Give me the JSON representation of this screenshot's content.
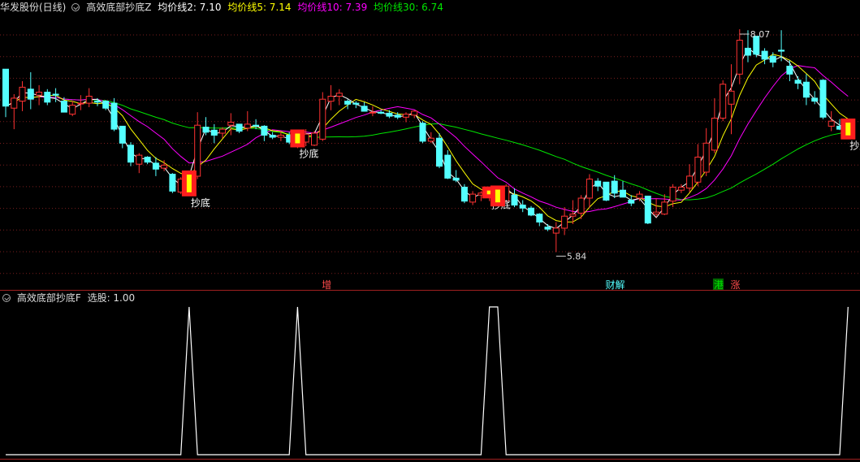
{
  "header": {
    "stock_name": "华发股份(日线)",
    "indicator_name": "高效底部抄底Z",
    "ma2_label": "均价线2: 7.10",
    "ma5_label": "均价线5: 7.14",
    "ma10_label": "均价线10: 7.39",
    "ma30_label": "均价线30: 6.74"
  },
  "sub_header": {
    "indicator_name": "高效底部抄底F",
    "value_label": "选股: 1.00"
  },
  "colors": {
    "background": "#000000",
    "up_candle": "#ff3232",
    "down_candle": "#54ffff",
    "ma2": "#ffffff",
    "ma5": "#ffff00",
    "ma10": "#ff00ff",
    "ma30": "#00e600",
    "grid": "#7a1e1e",
    "signal_line": "#ffffff"
  },
  "chart_data": [
    {
      "type": "candlestick",
      "title": "华发股份(日线)",
      "ylim": [
        5.6,
        8.2
      ],
      "price_high_label": "8.07",
      "price_low_label": "5.84",
      "signal_label": "抄底",
      "signal_indices": [
        22,
        35,
        58,
        59,
        101
      ],
      "markers": [
        {
          "text": "增",
          "index": 38,
          "color": "#ff4b4b"
        },
        {
          "text": "财解",
          "index": 72,
          "color": "#54ffff"
        },
        {
          "text": "港",
          "index": 85,
          "color": "#00e600",
          "box": "#006400"
        },
        {
          "text": "涨",
          "index": 87,
          "color": "#ff4b4b"
        }
      ],
      "candles": [
        {
          "o": 7.67,
          "h": 7.67,
          "l": 7.19,
          "c": 7.3
        },
        {
          "o": 7.28,
          "h": 7.42,
          "l": 7.07,
          "c": 7.38
        },
        {
          "o": 7.35,
          "h": 7.55,
          "l": 7.25,
          "c": 7.49
        },
        {
          "o": 7.47,
          "h": 7.64,
          "l": 7.27,
          "c": 7.37
        },
        {
          "o": 7.41,
          "h": 7.51,
          "l": 7.31,
          "c": 7.44
        },
        {
          "o": 7.44,
          "h": 7.47,
          "l": 7.31,
          "c": 7.34
        },
        {
          "o": 7.42,
          "h": 7.48,
          "l": 7.34,
          "c": 7.41
        },
        {
          "o": 7.35,
          "h": 7.39,
          "l": 7.24,
          "c": 7.24
        },
        {
          "o": 7.22,
          "h": 7.35,
          "l": 7.2,
          "c": 7.31
        },
        {
          "o": 7.33,
          "h": 7.41,
          "l": 7.26,
          "c": 7.33
        },
        {
          "o": 7.33,
          "h": 7.48,
          "l": 7.29,
          "c": 7.4
        },
        {
          "o": 7.35,
          "h": 7.38,
          "l": 7.3,
          "c": 7.34
        },
        {
          "o": 7.35,
          "h": 7.36,
          "l": 7.26,
          "c": 7.28
        },
        {
          "o": 7.33,
          "h": 7.38,
          "l": 7.05,
          "c": 7.07
        },
        {
          "o": 7.1,
          "h": 7.1,
          "l": 6.88,
          "c": 6.93
        },
        {
          "o": 6.91,
          "h": 6.94,
          "l": 6.7,
          "c": 6.74
        },
        {
          "o": 6.72,
          "h": 6.83,
          "l": 6.63,
          "c": 6.81
        },
        {
          "o": 6.79,
          "h": 6.8,
          "l": 6.72,
          "c": 6.74
        },
        {
          "o": 6.73,
          "h": 6.79,
          "l": 6.6,
          "c": 6.67
        },
        {
          "o": 6.68,
          "h": 6.76,
          "l": 6.65,
          "c": 6.71
        },
        {
          "o": 6.62,
          "h": 6.63,
          "l": 6.43,
          "c": 6.45
        },
        {
          "o": 6.44,
          "h": 6.59,
          "l": 6.42,
          "c": 6.57
        },
        {
          "o": 6.43,
          "h": 6.64,
          "l": 6.43,
          "c": 6.63
        },
        {
          "o": 6.6,
          "h": 7.24,
          "l": 6.57,
          "c": 7.11
        },
        {
          "o": 7.09,
          "h": 7.19,
          "l": 7.01,
          "c": 7.04
        },
        {
          "o": 7.06,
          "h": 7.12,
          "l": 6.93,
          "c": 7.01
        },
        {
          "o": 7.03,
          "h": 7.09,
          "l": 6.98,
          "c": 7.07
        },
        {
          "o": 7.11,
          "h": 7.23,
          "l": 7.01,
          "c": 7.14
        },
        {
          "o": 7.12,
          "h": 7.12,
          "l": 7.03,
          "c": 7.05
        },
        {
          "o": 7.08,
          "h": 7.25,
          "l": 7.05,
          "c": 7.12
        },
        {
          "o": 7.11,
          "h": 7.17,
          "l": 7.07,
          "c": 7.1
        },
        {
          "o": 7.1,
          "h": 7.11,
          "l": 6.95,
          "c": 7.01
        },
        {
          "o": 7.01,
          "h": 7.04,
          "l": 6.97,
          "c": 6.99
        },
        {
          "o": 6.99,
          "h": 7.05,
          "l": 6.95,
          "c": 7.01
        },
        {
          "o": 7.01,
          "h": 7.04,
          "l": 6.92,
          "c": 6.94
        },
        {
          "o": 6.92,
          "h": 7.05,
          "l": 6.88,
          "c": 7.03
        },
        {
          "o": 6.94,
          "h": 7.07,
          "l": 6.9,
          "c": 7.02
        },
        {
          "o": 6.91,
          "h": 7.05,
          "l": 6.9,
          "c": 7.03
        },
        {
          "o": 6.97,
          "h": 7.44,
          "l": 6.95,
          "c": 7.37
        },
        {
          "o": 7.35,
          "h": 7.51,
          "l": 7.26,
          "c": 7.4
        },
        {
          "o": 7.4,
          "h": 7.47,
          "l": 7.31,
          "c": 7.43
        },
        {
          "o": 7.35,
          "h": 7.37,
          "l": 7.27,
          "c": 7.32
        },
        {
          "o": 7.33,
          "h": 7.35,
          "l": 7.28,
          "c": 7.32
        },
        {
          "o": 7.3,
          "h": 7.34,
          "l": 7.25,
          "c": 7.25
        },
        {
          "o": 7.24,
          "h": 7.3,
          "l": 7.2,
          "c": 7.24
        },
        {
          "o": 7.24,
          "h": 7.26,
          "l": 7.22,
          "c": 7.23
        },
        {
          "o": 7.23,
          "h": 7.26,
          "l": 7.18,
          "c": 7.2
        },
        {
          "o": 7.21,
          "h": 7.24,
          "l": 7.17,
          "c": 7.19
        },
        {
          "o": 7.19,
          "h": 7.24,
          "l": 7.14,
          "c": 7.22
        },
        {
          "o": 7.21,
          "h": 7.26,
          "l": 7.18,
          "c": 7.25
        },
        {
          "o": 7.13,
          "h": 7.15,
          "l": 6.93,
          "c": 6.95
        },
        {
          "o": 6.95,
          "h": 7.04,
          "l": 6.93,
          "c": 6.98
        },
        {
          "o": 6.98,
          "h": 7.03,
          "l": 6.68,
          "c": 6.7
        },
        {
          "o": 6.81,
          "h": 6.86,
          "l": 6.57,
          "c": 6.58
        },
        {
          "o": 6.58,
          "h": 6.66,
          "l": 6.54,
          "c": 6.56
        },
        {
          "o": 6.49,
          "h": 6.52,
          "l": 6.33,
          "c": 6.35
        },
        {
          "o": 6.34,
          "h": 6.45,
          "l": 6.31,
          "c": 6.42
        },
        {
          "o": 6.41,
          "h": 6.45,
          "l": 6.35,
          "c": 6.43
        },
        {
          "o": 6.41,
          "h": 6.48,
          "l": 6.35,
          "c": 6.41
        },
        {
          "o": 6.33,
          "h": 6.49,
          "l": 6.31,
          "c": 6.46
        },
        {
          "o": 6.35,
          "h": 6.52,
          "l": 6.34,
          "c": 6.5
        },
        {
          "o": 6.41,
          "h": 6.48,
          "l": 6.29,
          "c": 6.31
        },
        {
          "o": 6.31,
          "h": 6.36,
          "l": 6.24,
          "c": 6.28
        },
        {
          "o": 6.28,
          "h": 6.3,
          "l": 6.2,
          "c": 6.21
        },
        {
          "o": 6.22,
          "h": 6.23,
          "l": 6.1,
          "c": 6.14
        },
        {
          "o": 6.09,
          "h": 6.12,
          "l": 6.05,
          "c": 6.07
        },
        {
          "o": 6.03,
          "h": 6.14,
          "l": 5.84,
          "c": 6.08
        },
        {
          "o": 6.08,
          "h": 6.29,
          "l": 6.01,
          "c": 6.2
        },
        {
          "o": 6.2,
          "h": 6.36,
          "l": 6.12,
          "c": 6.22
        },
        {
          "o": 6.23,
          "h": 6.41,
          "l": 6.17,
          "c": 6.38
        },
        {
          "o": 6.38,
          "h": 6.62,
          "l": 6.28,
          "c": 6.57
        },
        {
          "o": 6.55,
          "h": 6.58,
          "l": 6.45,
          "c": 6.5
        },
        {
          "o": 6.54,
          "h": 6.54,
          "l": 6.35,
          "c": 6.36
        },
        {
          "o": 6.55,
          "h": 6.61,
          "l": 6.38,
          "c": 6.43
        },
        {
          "o": 6.46,
          "h": 6.55,
          "l": 6.39,
          "c": 6.39
        },
        {
          "o": 6.36,
          "h": 6.41,
          "l": 6.3,
          "c": 6.33
        },
        {
          "o": 6.38,
          "h": 6.45,
          "l": 6.35,
          "c": 6.42
        },
        {
          "o": 6.4,
          "h": 6.4,
          "l": 6.12,
          "c": 6.13
        },
        {
          "o": 6.22,
          "h": 6.38,
          "l": 6.19,
          "c": 6.24
        },
        {
          "o": 6.22,
          "h": 6.42,
          "l": 6.21,
          "c": 6.34
        },
        {
          "o": 6.35,
          "h": 6.52,
          "l": 6.29,
          "c": 6.49
        },
        {
          "o": 6.46,
          "h": 6.52,
          "l": 6.43,
          "c": 6.49
        },
        {
          "o": 6.48,
          "h": 6.72,
          "l": 6.44,
          "c": 6.6
        },
        {
          "o": 6.54,
          "h": 6.92,
          "l": 6.5,
          "c": 6.79
        },
        {
          "o": 6.64,
          "h": 7.08,
          "l": 6.6,
          "c": 6.93
        },
        {
          "o": 6.86,
          "h": 7.38,
          "l": 6.83,
          "c": 7.18
        },
        {
          "o": 7.18,
          "h": 7.56,
          "l": 7.15,
          "c": 7.52
        },
        {
          "o": 7.32,
          "h": 7.72,
          "l": 7.02,
          "c": 7.45
        },
        {
          "o": 7.62,
          "h": 8.07,
          "l": 7.52,
          "c": 7.96
        },
        {
          "o": 7.88,
          "h": 8.06,
          "l": 7.74,
          "c": 7.81
        },
        {
          "o": 8.0,
          "h": 8.0,
          "l": 7.79,
          "c": 7.82
        },
        {
          "o": 7.85,
          "h": 7.88,
          "l": 7.72,
          "c": 7.77
        },
        {
          "o": 7.8,
          "h": 7.84,
          "l": 7.69,
          "c": 7.74
        },
        {
          "o": 7.86,
          "h": 8.06,
          "l": 7.75,
          "c": 7.85
        },
        {
          "o": 7.7,
          "h": 7.76,
          "l": 7.55,
          "c": 7.62
        },
        {
          "o": 7.56,
          "h": 7.6,
          "l": 7.47,
          "c": 7.53
        },
        {
          "o": 7.54,
          "h": 7.62,
          "l": 7.31,
          "c": 7.39
        },
        {
          "o": 7.38,
          "h": 7.45,
          "l": 7.32,
          "c": 7.35
        },
        {
          "o": 7.56,
          "h": 7.57,
          "l": 7.17,
          "c": 7.19
        },
        {
          "o": 7.1,
          "h": 7.25,
          "l": 7.05,
          "c": 7.15
        },
        {
          "o": 7.1,
          "h": 7.17,
          "l": 7.06,
          "c": 7.07
        },
        {
          "o": 7.0,
          "h": 7.16,
          "l": 6.98,
          "c": 7.1
        }
      ]
    },
    {
      "type": "line",
      "title": "高效底部抄底F",
      "ylim": [
        0,
        1
      ],
      "series": [
        {
          "name": "选股",
          "values": [
            0,
            0,
            0,
            0,
            0,
            0,
            0,
            0,
            0,
            0,
            0,
            0,
            0,
            0,
            0,
            0,
            0,
            0,
            0,
            0,
            0,
            0,
            1,
            0,
            0,
            0,
            0,
            0,
            0,
            0,
            0,
            0,
            0,
            0,
            0,
            1,
            0,
            0,
            0,
            0,
            0,
            0,
            0,
            0,
            0,
            0,
            0,
            0,
            0,
            0,
            0,
            0,
            0,
            0,
            0,
            0,
            0,
            0,
            1,
            1,
            0,
            0,
            0,
            0,
            0,
            0,
            0,
            0,
            0,
            0,
            0,
            0,
            0,
            0,
            0,
            0,
            0,
            0,
            0,
            0,
            0,
            0,
            0,
            0,
            0,
            0,
            0,
            0,
            0,
            0,
            0,
            0,
            0,
            0,
            0,
            0,
            0,
            0,
            0,
            0,
            0,
            1
          ]
        }
      ]
    }
  ]
}
